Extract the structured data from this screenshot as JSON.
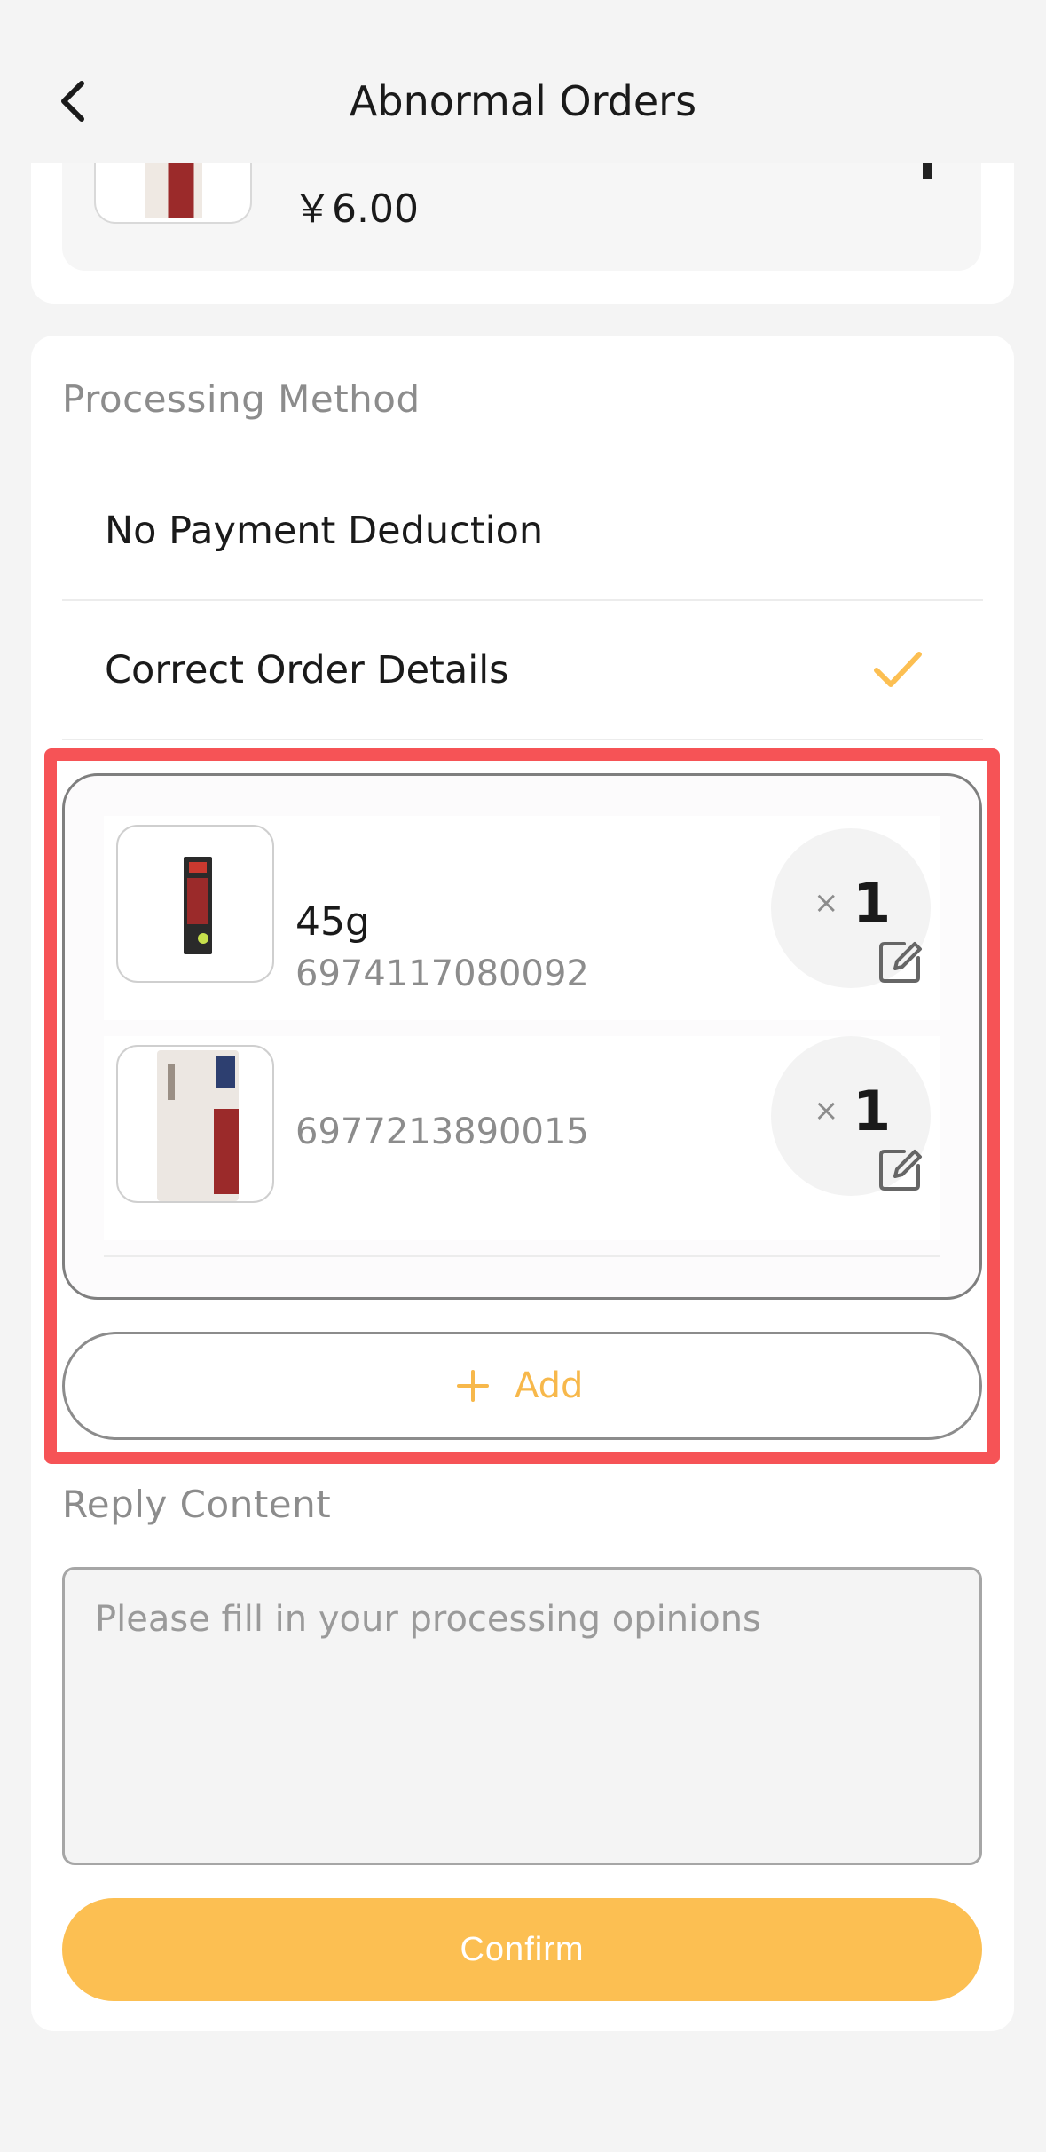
{
  "nav": {
    "title": "Abnormal Orders"
  },
  "top_item": {
    "price": "￥6.00"
  },
  "processing": {
    "section_label": "Processing Method",
    "options": [
      {
        "label": "No Payment Deduction",
        "selected": false
      },
      {
        "label": "Correct Order Details",
        "selected": true
      }
    ]
  },
  "items": [
    {
      "name": "45g",
      "code": "6974117080092",
      "qty_prefix": "×",
      "qty": "1"
    },
    {
      "name": "",
      "code": "6977213890015",
      "qty_prefix": "×",
      "qty": "1"
    }
  ],
  "add_button": {
    "label": "Add"
  },
  "reply": {
    "section_label": "Reply Content",
    "placeholder": "Please fill in your processing opinions",
    "value": ""
  },
  "confirm_button": {
    "label": "Confirm"
  },
  "colors": {
    "accent": "#fcbf52",
    "accent_text": "#f7b84b",
    "highlight": "#f65356",
    "background": "#f4f4f4"
  },
  "icons": {
    "back": "chevron-left-icon",
    "check": "check-icon",
    "edit": "edit-icon",
    "add": "plus-icon"
  }
}
